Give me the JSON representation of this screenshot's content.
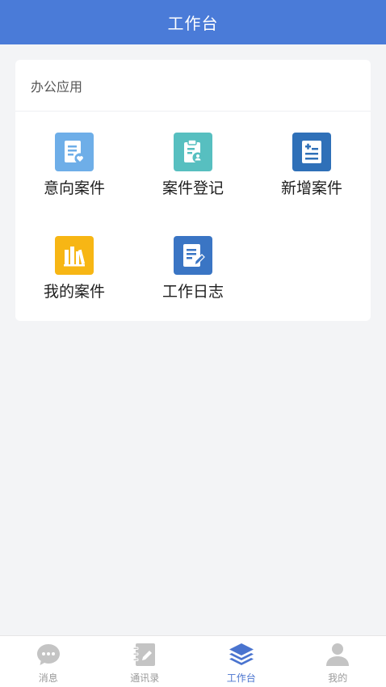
{
  "header": {
    "title": "工作台"
  },
  "section": {
    "title": "办公应用"
  },
  "apps": [
    {
      "label": "意向案件",
      "icon": "intent-case-icon",
      "color": "#6eaee8"
    },
    {
      "label": "案件登记",
      "icon": "case-register-icon",
      "color": "#57bfc0"
    },
    {
      "label": "新增案件",
      "icon": "add-case-icon",
      "color": "#2f70b8"
    },
    {
      "label": "我的案件",
      "icon": "my-case-icon",
      "color": "#f7b614"
    },
    {
      "label": "工作日志",
      "icon": "work-log-icon",
      "color": "#3a75c4"
    }
  ],
  "tabbar": {
    "items": [
      {
        "label": "消息",
        "icon": "message-icon"
      },
      {
        "label": "通讯录",
        "icon": "contacts-icon"
      },
      {
        "label": "工作台",
        "icon": "workbench-icon",
        "active": true
      },
      {
        "label": "我的",
        "icon": "profile-icon"
      }
    ]
  },
  "colors": {
    "primary": "#4a7bd8",
    "active_tab": "#4a74cf",
    "inactive_tab": "#c4c4c4"
  }
}
